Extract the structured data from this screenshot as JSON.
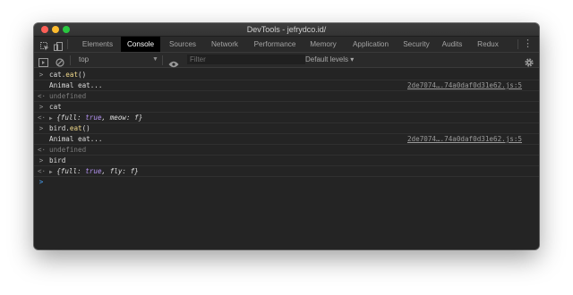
{
  "window": {
    "title": "DevTools - jefrydco.id/"
  },
  "tabs": [
    {
      "label": "Elements"
    },
    {
      "label": "Console",
      "active": true
    },
    {
      "label": "Sources"
    },
    {
      "label": "Network"
    },
    {
      "label": "Performance"
    },
    {
      "label": "Memory"
    },
    {
      "label": "Application"
    },
    {
      "label": "Security"
    },
    {
      "label": "Audits"
    },
    {
      "label": "Redux"
    }
  ],
  "toolbar": {
    "context": "top",
    "filter_placeholder": "Filter",
    "levels": "Default levels ▾"
  },
  "console": {
    "rows": [
      {
        "type": "input",
        "gutter": ">",
        "obj": "cat",
        "method": "eat",
        "call": "()"
      },
      {
        "type": "log",
        "text": "Animal eat...",
        "source": "2de7074….74a0daf0d31e62.js:5"
      },
      {
        "type": "result",
        "gutter": "<·",
        "text": "undefined"
      },
      {
        "type": "input",
        "gutter": ">",
        "text": "cat"
      },
      {
        "type": "object",
        "gutter": "<·",
        "open": "{",
        "k1": "full",
        "v1": "true",
        "k2": "meow",
        "v2": "f",
        "close": "}"
      },
      {
        "type": "input",
        "gutter": ">",
        "obj": "bird",
        "method": "eat",
        "call": "()"
      },
      {
        "type": "log",
        "text": "Animal eat...",
        "source": "2de7074….74a0daf0d31e62.js:5"
      },
      {
        "type": "result",
        "gutter": "<·",
        "text": "undefined"
      },
      {
        "type": "input",
        "gutter": ">",
        "text": "bird"
      },
      {
        "type": "object",
        "gutter": "<·",
        "open": "{",
        "k1": "full",
        "v1": "true",
        "k2": "fly",
        "v2": "f",
        "close": "}"
      },
      {
        "type": "prompt",
        "gutter": ">"
      }
    ]
  },
  "colors": {
    "accent_prompt": "#4aa8ff",
    "keyword": "#b392f0",
    "function": "#f1d98b"
  }
}
